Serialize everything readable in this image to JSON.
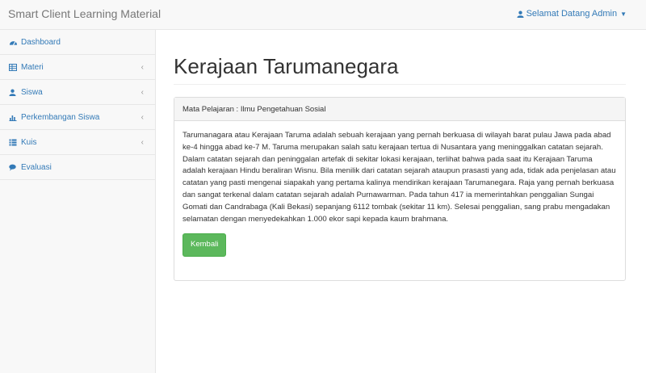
{
  "navbar": {
    "brand": "Smart Client Learning Material",
    "user_menu": "Selamat Datang Admin"
  },
  "sidebar": {
    "items": [
      {
        "label": "Dashboard",
        "icon": "dashboard-icon",
        "has_submenu": false
      },
      {
        "label": "Materi",
        "icon": "table-icon",
        "has_submenu": true
      },
      {
        "label": "Siswa",
        "icon": "user-icon",
        "has_submenu": true
      },
      {
        "label": "Perkembangan Siswa",
        "icon": "bar-chart-icon",
        "has_submenu": true
      },
      {
        "label": "Kuis",
        "icon": "list-icon",
        "has_submenu": true
      },
      {
        "label": "Evaluasi",
        "icon": "comments-icon",
        "has_submenu": false
      }
    ]
  },
  "main": {
    "title": "Kerajaan Tarumanegara",
    "panel_heading": "Mata Pelajaran : Ilmu Pengetahuan Sosial",
    "body_text": "Tarumanagara atau Kerajaan Taruma adalah sebuah kerajaan yang pernah berkuasa di wilayah barat pulau Jawa pada abad ke-4 hingga abad ke-7 M. Taruma merupakan salah satu kerajaan tertua di Nusantara yang meninggalkan catatan sejarah. Dalam catatan sejarah dan peninggalan artefak di sekitar lokasi kerajaan, terlihat bahwa pada saat itu Kerajaan Taruma adalah kerajaan Hindu beraliran Wisnu. Bila menilik dari catatan sejarah ataupun prasasti yang ada, tidak ada penjelasan atau catatan yang pasti mengenai siapakah yang pertama kalinya mendirikan kerajaan Tarumanegara. Raja yang pernah berkuasa dan sangat terkenal dalam catatan sejarah adalah Purnawarman. Pada tahun 417 ia memerintahkan penggalian Sungai Gomati dan Candrabaga (Kali Bekasi) sepanjang 6112 tombak (sekitar 11 km). Selesai penggalian, sang prabu mengadakan selamatan dengan menyedekahkan 1.000 ekor sapi kepada kaum brahmana.",
    "back_button": "Kembali"
  },
  "colors": {
    "link": "#337ab7",
    "success": "#5cb85c"
  }
}
